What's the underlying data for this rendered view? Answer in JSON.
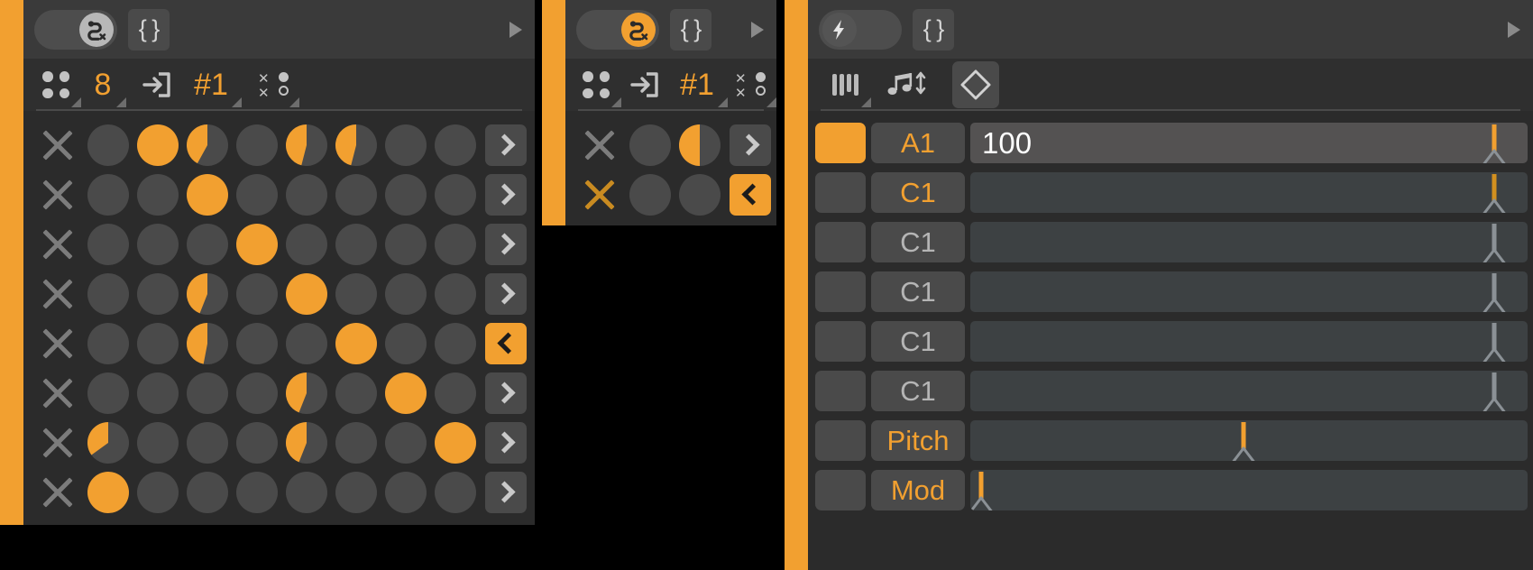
{
  "theme": {
    "accent": "#f2a030",
    "accent_dim": "#c98b21",
    "panel_bg": "#2b2b2b",
    "header_bg": "#3a3a3a",
    "cell_off": "#4a4a4a",
    "page_bg": "#000000"
  },
  "panel_left": {
    "header": {
      "toggle_icon": "snake-x-icon",
      "toggle_state": "off",
      "brace_label": "{ }",
      "play_icon": "play-triangle-icon"
    },
    "toolbar": [
      {
        "name": "four-dots-icon",
        "icon": "four-dots-icon",
        "label": ""
      },
      {
        "name": "steps-count",
        "icon": "",
        "label": "8"
      },
      {
        "name": "enter-box-icon",
        "icon": "enter-box-icon",
        "label": ""
      },
      {
        "name": "pattern-number",
        "icon": "",
        "label": "#1"
      },
      {
        "name": "randomize-icon",
        "icon": "x-o-icon",
        "label": ""
      }
    ],
    "rows": [
      {
        "clear_label": "x",
        "clear_active": false,
        "steps": [
          0,
          100,
          42,
          0,
          46,
          46,
          0,
          0
        ],
        "end_button": "chevron-right",
        "end_selected": false
      },
      {
        "clear_label": "x",
        "clear_active": false,
        "steps": [
          0,
          0,
          100,
          0,
          0,
          0,
          0,
          0
        ],
        "end_button": "chevron-right",
        "end_selected": false
      },
      {
        "clear_label": "x",
        "clear_active": false,
        "steps": [
          0,
          0,
          0,
          100,
          0,
          0,
          0,
          0
        ],
        "end_button": "chevron-right",
        "end_selected": false
      },
      {
        "clear_label": "x",
        "clear_active": false,
        "steps": [
          0,
          0,
          44,
          0,
          100,
          0,
          0,
          0
        ],
        "end_button": "chevron-right",
        "end_selected": false
      },
      {
        "clear_label": "x",
        "clear_active": false,
        "steps": [
          0,
          0,
          47,
          0,
          0,
          100,
          0,
          0
        ],
        "end_button": "chevron-left",
        "end_selected": true
      },
      {
        "clear_label": "x",
        "clear_active": false,
        "steps": [
          0,
          0,
          0,
          0,
          44,
          0,
          100,
          0
        ],
        "end_button": "chevron-right",
        "end_selected": false
      },
      {
        "clear_label": "x",
        "clear_active": false,
        "steps": [
          35,
          0,
          0,
          0,
          44,
          0,
          0,
          100
        ],
        "end_button": "chevron-right",
        "end_selected": false
      },
      {
        "clear_label": "x",
        "clear_active": false,
        "steps": [
          100,
          0,
          0,
          0,
          0,
          0,
          0,
          0
        ],
        "end_button": "chevron-right",
        "end_selected": false
      }
    ]
  },
  "panel_mid": {
    "header": {
      "toggle_icon": "snake-x-icon",
      "toggle_state": "on",
      "brace_label": "{ }",
      "play_icon": "play-triangle-icon"
    },
    "toolbar": [
      {
        "name": "four-dots-icon",
        "icon": "four-dots-icon",
        "label": ""
      },
      {
        "name": "enter-box-icon",
        "icon": "enter-box-icon",
        "label": ""
      },
      {
        "name": "pattern-number",
        "icon": "",
        "label": "#1"
      },
      {
        "name": "randomize-icon",
        "icon": "x-o-icon",
        "label": ""
      }
    ],
    "rows": [
      {
        "clear_label": "x",
        "clear_active": false,
        "steps": [
          0,
          50
        ],
        "end_button": "chevron-right",
        "end_selected": false
      },
      {
        "clear_label": "x",
        "clear_active": true,
        "steps": [
          0,
          0
        ],
        "end_button": "chevron-left",
        "end_selected": true
      }
    ]
  },
  "panel_right": {
    "header": {
      "toggle_icon": "lightning-bolt-icon",
      "toggle_state": "lit",
      "brace_label": "{ }",
      "play_icon": "play-triangle-icon"
    },
    "toolbar": [
      {
        "name": "piano-keys-icon",
        "icon": "piano-keys-icon",
        "label": ""
      },
      {
        "name": "note-updown-icon",
        "icon": "note-updown-icon",
        "label": ""
      },
      {
        "name": "diamond-icon",
        "icon": "diamond-icon",
        "label": "",
        "boxed": true
      }
    ],
    "rows": [
      {
        "swatch_on": true,
        "note": "A1",
        "note_active": true,
        "value": "100",
        "slider_highlight": true,
        "handle_pct": 94,
        "handle_color": "amber"
      },
      {
        "swatch_on": false,
        "note": "C1",
        "note_active": true,
        "value": "",
        "slider_highlight": false,
        "handle_pct": 94,
        "handle_color": "amber2"
      },
      {
        "swatch_on": false,
        "note": "C1",
        "note_active": false,
        "value": "",
        "slider_highlight": false,
        "handle_pct": 94,
        "handle_color": "gray"
      },
      {
        "swatch_on": false,
        "note": "C1",
        "note_active": false,
        "value": "",
        "slider_highlight": false,
        "handle_pct": 94,
        "handle_color": "gray"
      },
      {
        "swatch_on": false,
        "note": "C1",
        "note_active": false,
        "value": "",
        "slider_highlight": false,
        "handle_pct": 94,
        "handle_color": "gray"
      },
      {
        "swatch_on": false,
        "note": "C1",
        "note_active": false,
        "value": "",
        "slider_highlight": false,
        "handle_pct": 94,
        "handle_color": "gray"
      },
      {
        "swatch_on": false,
        "note": "Pitch",
        "note_active": true,
        "value": "",
        "slider_highlight": false,
        "handle_pct": 49,
        "handle_color": "amber"
      },
      {
        "swatch_on": false,
        "note": "Mod",
        "note_active": true,
        "value": "",
        "slider_highlight": false,
        "handle_pct": 2,
        "handle_color": "amber"
      }
    ]
  }
}
